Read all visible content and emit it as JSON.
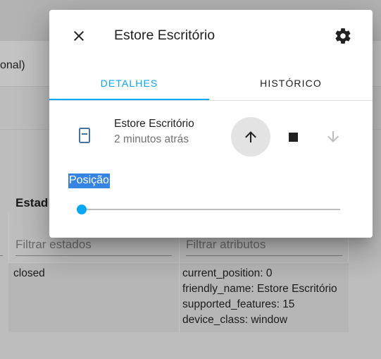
{
  "background": {
    "optional_fragment": "onal)",
    "table": {
      "header_state": "Estad",
      "filter_states_placeholder": "Filtrar estados",
      "filter_attributes_placeholder": "Filtrar atributos",
      "row": {
        "state": "closed",
        "attributes": [
          "current_position: 0",
          "friendly_name: Estore Escritório",
          "supported_features: 15",
          "device_class: window"
        ]
      }
    }
  },
  "dialog": {
    "title": "Estore Escritório",
    "close_icon": "close-icon",
    "settings_icon": "gear-icon",
    "tabs": [
      {
        "label": "DETALHES",
        "active": true
      },
      {
        "label": "HISTÓRICO",
        "active": false
      }
    ],
    "entity": {
      "icon": "window-shutter-icon",
      "name": "Estore Escritório",
      "last_changed": "2 minutos atrás"
    },
    "controls": {
      "open_icon": "arrow-up-icon",
      "stop_icon": "stop-icon",
      "close_icon": "arrow-down-icon",
      "close_disabled": true
    },
    "position": {
      "label": "Posição",
      "value": 0,
      "min": 0,
      "max": 100
    }
  },
  "colors": {
    "accent": "#03a9f4",
    "scrim_background": "#bdbdbd",
    "label_highlight": "#3584e4"
  }
}
